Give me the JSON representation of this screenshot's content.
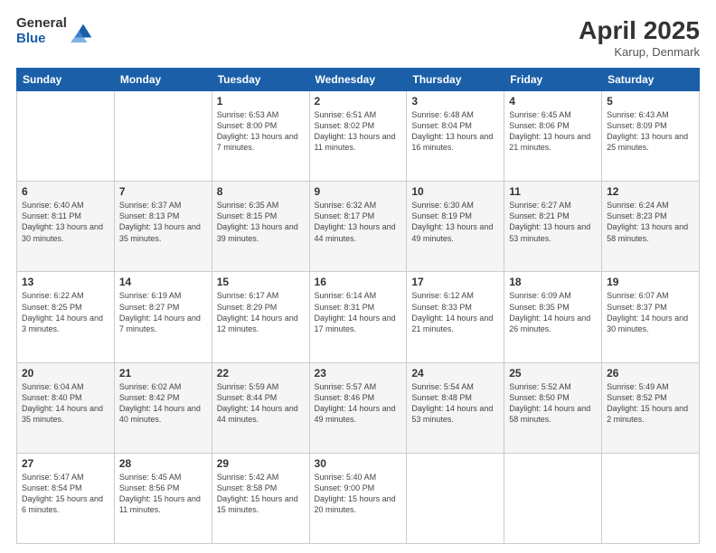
{
  "header": {
    "logo_general": "General",
    "logo_blue": "Blue",
    "month_title": "April 2025",
    "subtitle": "Karup, Denmark"
  },
  "days_of_week": [
    "Sunday",
    "Monday",
    "Tuesday",
    "Wednesday",
    "Thursday",
    "Friday",
    "Saturday"
  ],
  "weeks": [
    [
      {
        "day": "",
        "info": ""
      },
      {
        "day": "",
        "info": ""
      },
      {
        "day": "1",
        "info": "Sunrise: 6:53 AM\nSunset: 8:00 PM\nDaylight: 13 hours and 7 minutes."
      },
      {
        "day": "2",
        "info": "Sunrise: 6:51 AM\nSunset: 8:02 PM\nDaylight: 13 hours and 11 minutes."
      },
      {
        "day": "3",
        "info": "Sunrise: 6:48 AM\nSunset: 8:04 PM\nDaylight: 13 hours and 16 minutes."
      },
      {
        "day": "4",
        "info": "Sunrise: 6:45 AM\nSunset: 8:06 PM\nDaylight: 13 hours and 21 minutes."
      },
      {
        "day": "5",
        "info": "Sunrise: 6:43 AM\nSunset: 8:09 PM\nDaylight: 13 hours and 25 minutes."
      }
    ],
    [
      {
        "day": "6",
        "info": "Sunrise: 6:40 AM\nSunset: 8:11 PM\nDaylight: 13 hours and 30 minutes."
      },
      {
        "day": "7",
        "info": "Sunrise: 6:37 AM\nSunset: 8:13 PM\nDaylight: 13 hours and 35 minutes."
      },
      {
        "day": "8",
        "info": "Sunrise: 6:35 AM\nSunset: 8:15 PM\nDaylight: 13 hours and 39 minutes."
      },
      {
        "day": "9",
        "info": "Sunrise: 6:32 AM\nSunset: 8:17 PM\nDaylight: 13 hours and 44 minutes."
      },
      {
        "day": "10",
        "info": "Sunrise: 6:30 AM\nSunset: 8:19 PM\nDaylight: 13 hours and 49 minutes."
      },
      {
        "day": "11",
        "info": "Sunrise: 6:27 AM\nSunset: 8:21 PM\nDaylight: 13 hours and 53 minutes."
      },
      {
        "day": "12",
        "info": "Sunrise: 6:24 AM\nSunset: 8:23 PM\nDaylight: 13 hours and 58 minutes."
      }
    ],
    [
      {
        "day": "13",
        "info": "Sunrise: 6:22 AM\nSunset: 8:25 PM\nDaylight: 14 hours and 3 minutes."
      },
      {
        "day": "14",
        "info": "Sunrise: 6:19 AM\nSunset: 8:27 PM\nDaylight: 14 hours and 7 minutes."
      },
      {
        "day": "15",
        "info": "Sunrise: 6:17 AM\nSunset: 8:29 PM\nDaylight: 14 hours and 12 minutes."
      },
      {
        "day": "16",
        "info": "Sunrise: 6:14 AM\nSunset: 8:31 PM\nDaylight: 14 hours and 17 minutes."
      },
      {
        "day": "17",
        "info": "Sunrise: 6:12 AM\nSunset: 8:33 PM\nDaylight: 14 hours and 21 minutes."
      },
      {
        "day": "18",
        "info": "Sunrise: 6:09 AM\nSunset: 8:35 PM\nDaylight: 14 hours and 26 minutes."
      },
      {
        "day": "19",
        "info": "Sunrise: 6:07 AM\nSunset: 8:37 PM\nDaylight: 14 hours and 30 minutes."
      }
    ],
    [
      {
        "day": "20",
        "info": "Sunrise: 6:04 AM\nSunset: 8:40 PM\nDaylight: 14 hours and 35 minutes."
      },
      {
        "day": "21",
        "info": "Sunrise: 6:02 AM\nSunset: 8:42 PM\nDaylight: 14 hours and 40 minutes."
      },
      {
        "day": "22",
        "info": "Sunrise: 5:59 AM\nSunset: 8:44 PM\nDaylight: 14 hours and 44 minutes."
      },
      {
        "day": "23",
        "info": "Sunrise: 5:57 AM\nSunset: 8:46 PM\nDaylight: 14 hours and 49 minutes."
      },
      {
        "day": "24",
        "info": "Sunrise: 5:54 AM\nSunset: 8:48 PM\nDaylight: 14 hours and 53 minutes."
      },
      {
        "day": "25",
        "info": "Sunrise: 5:52 AM\nSunset: 8:50 PM\nDaylight: 14 hours and 58 minutes."
      },
      {
        "day": "26",
        "info": "Sunrise: 5:49 AM\nSunset: 8:52 PM\nDaylight: 15 hours and 2 minutes."
      }
    ],
    [
      {
        "day": "27",
        "info": "Sunrise: 5:47 AM\nSunset: 8:54 PM\nDaylight: 15 hours and 6 minutes."
      },
      {
        "day": "28",
        "info": "Sunrise: 5:45 AM\nSunset: 8:56 PM\nDaylight: 15 hours and 11 minutes."
      },
      {
        "day": "29",
        "info": "Sunrise: 5:42 AM\nSunset: 8:58 PM\nDaylight: 15 hours and 15 minutes."
      },
      {
        "day": "30",
        "info": "Sunrise: 5:40 AM\nSunset: 9:00 PM\nDaylight: 15 hours and 20 minutes."
      },
      {
        "day": "",
        "info": ""
      },
      {
        "day": "",
        "info": ""
      },
      {
        "day": "",
        "info": ""
      }
    ]
  ]
}
